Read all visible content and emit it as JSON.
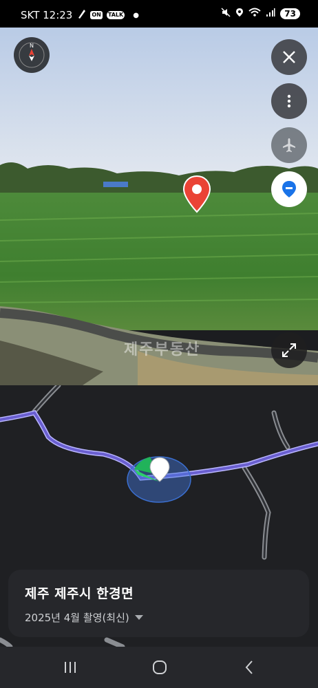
{
  "status_bar": {
    "carrier_time": "SKT 12:23",
    "badge_on": "ON",
    "badge_talk": "TALK",
    "battery": "73"
  },
  "street_view": {
    "watermark": "제주부동산"
  },
  "info_card": {
    "location": "제주 제주시 한경면",
    "capture_date": "2025년 4월 촬영(최신)"
  },
  "icons": {
    "compass": "compass-icon",
    "close": "close-icon",
    "more": "more-vert-icon",
    "flight": "airplane-icon",
    "location": "location-pin-icon",
    "expand": "expand-icon",
    "recents": "recents-icon",
    "home": "home-icon",
    "back": "back-icon"
  },
  "colors": {
    "accent_blue": "#1a73e8",
    "pin_red": "#ea4335",
    "map_bg": "#1f2023",
    "route_purple": "#7b6fd6"
  }
}
